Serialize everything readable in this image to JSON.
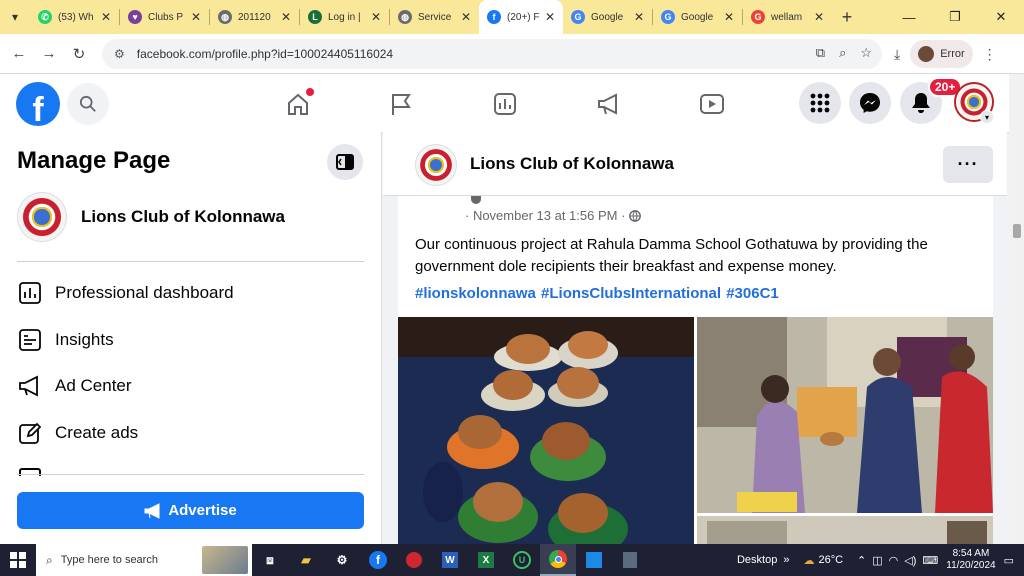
{
  "browser": {
    "tabs": [
      {
        "label": "(53) Wh",
        "color": "#25d366",
        "glyph": "✆"
      },
      {
        "label": "Clubs P",
        "color": "#7b3f99",
        "glyph": "♥"
      },
      {
        "label": "201120",
        "color": "#6b6b6b",
        "glyph": "◍"
      },
      {
        "label": "Log in |",
        "color": "#1a6e3a",
        "glyph": "L"
      },
      {
        "label": "Service",
        "color": "#6b6b6b",
        "glyph": "◍"
      },
      {
        "label": "(20+) F",
        "color": "#1877f2",
        "glyph": "f"
      },
      {
        "label": "Google",
        "color": "#4285f4",
        "glyph": "G"
      },
      {
        "label": "Google",
        "color": "#4285f4",
        "glyph": "G"
      },
      {
        "label": "wellam",
        "color": "#ea4335",
        "glyph": "G"
      }
    ],
    "url": "facebook.com/profile.php?id=100024405116024",
    "profile_label": "Error"
  },
  "fb": {
    "notif_badge": "20+",
    "left": {
      "title": "Manage Page",
      "page_name": "Lions Club of Kolonnawa",
      "items": [
        {
          "label": "Professional dashboard",
          "icon": "dashboard-icon"
        },
        {
          "label": "Insights",
          "icon": "insights-icon"
        },
        {
          "label": "Ad Center",
          "icon": "megaphone-icon"
        },
        {
          "label": "Create ads",
          "icon": "pencil-icon"
        }
      ],
      "advertise_label": "Advertise"
    },
    "post": {
      "page_name": "Lions Club of Kolonnawa",
      "meta": "· November 13 at 1:56 PM ·",
      "text": "Our continuous project at Rahula Damma School Gothatuwa by providing the government dole recipients their breakfast and expense money.",
      "hashtags": "#lionskolonnawa #LionsClubsInternational #306C1"
    }
  },
  "taskbar": {
    "search_placeholder": "Type here to search",
    "desktop_label": "Desktop",
    "temperature": "26°C",
    "time": "8:54 AM",
    "date": "11/20/2024"
  }
}
